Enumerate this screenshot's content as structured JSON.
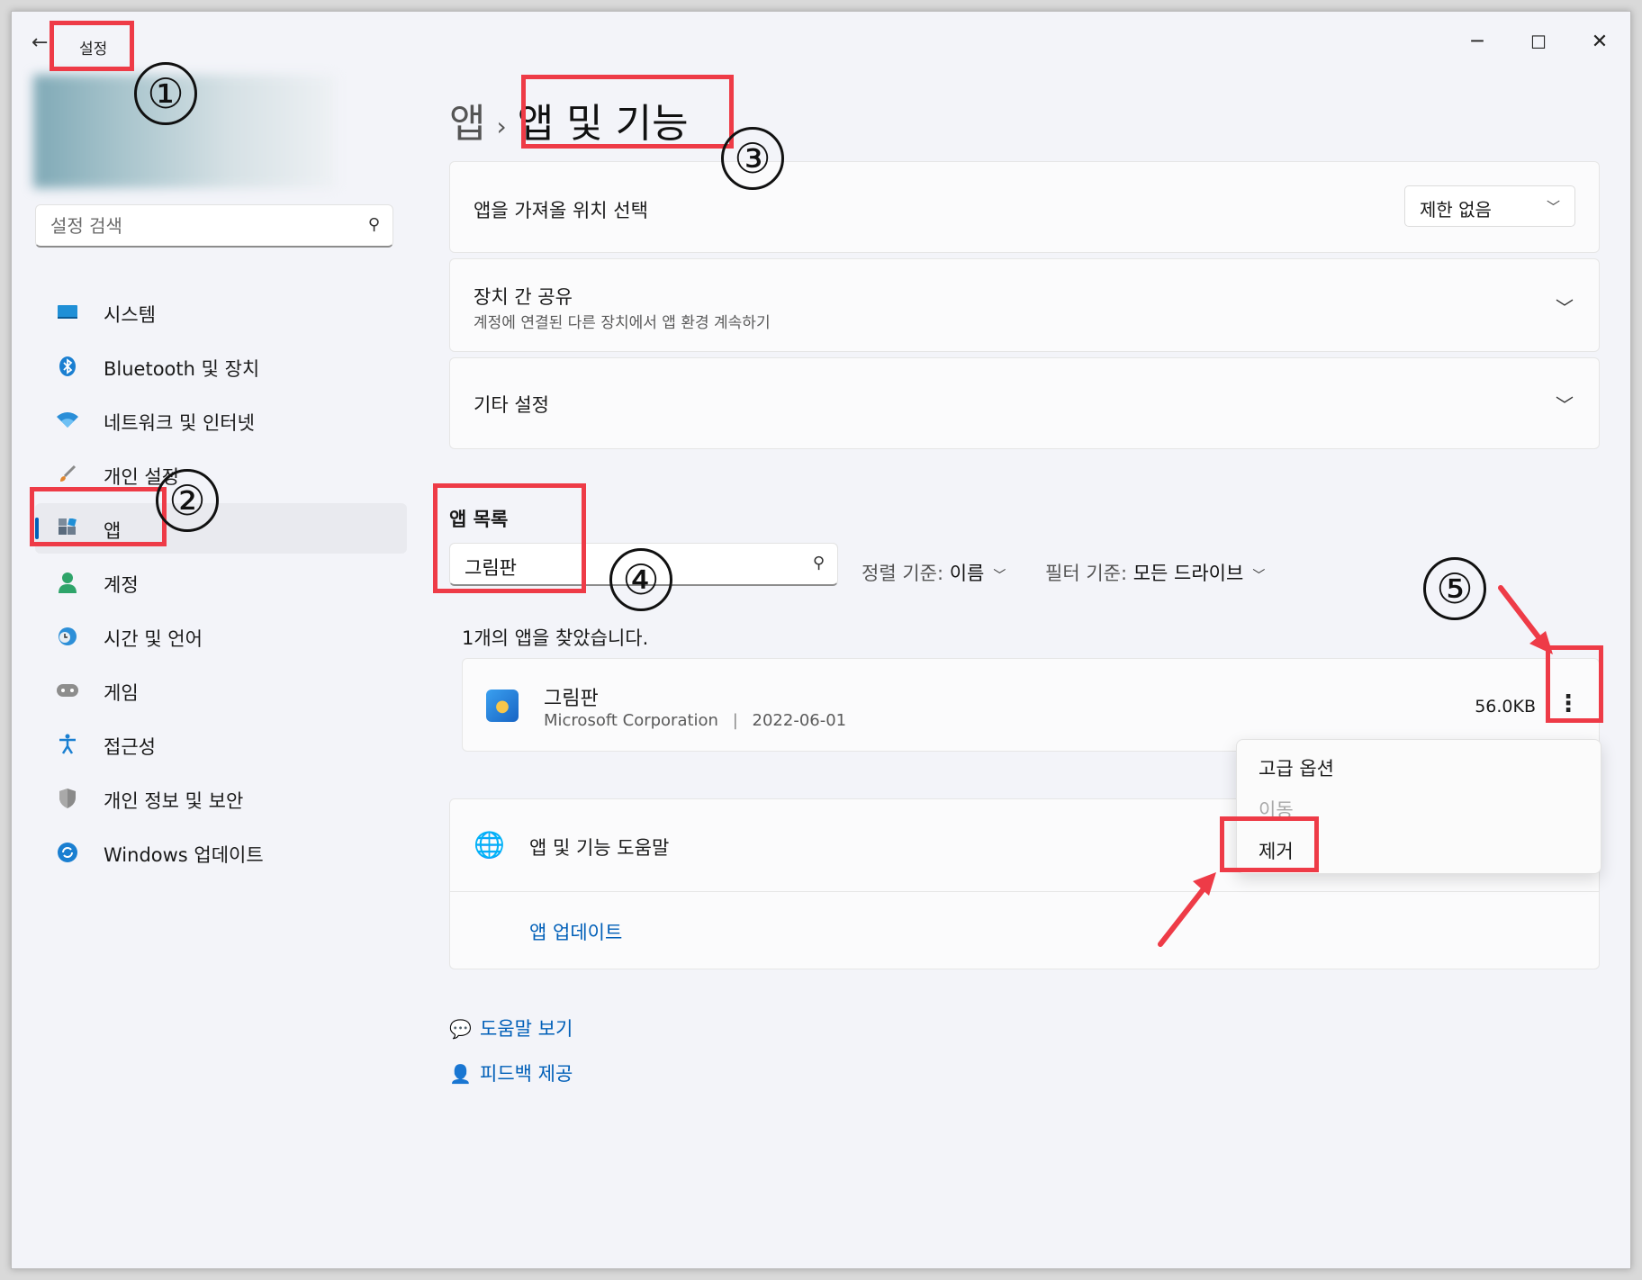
{
  "window": {
    "title": "설정",
    "back_icon": "←",
    "minimize": "─",
    "maximize": "☐",
    "close": "✕"
  },
  "sidebar": {
    "search_placeholder": "설정 검색",
    "items": [
      {
        "label": "시스템",
        "icon": "monitor-icon"
      },
      {
        "label": "Bluetooth 및 장치",
        "icon": "bluetooth-icon"
      },
      {
        "label": "네트워크 및 인터넷",
        "icon": "wifi-icon"
      },
      {
        "label": "개인 설정",
        "icon": "brush-icon"
      },
      {
        "label": "앱",
        "icon": "apps-icon",
        "active": true
      },
      {
        "label": "계정",
        "icon": "person-icon"
      },
      {
        "label": "시간 및 언어",
        "icon": "globe-clock-icon"
      },
      {
        "label": "게임",
        "icon": "gamepad-icon"
      },
      {
        "label": "접근성",
        "icon": "accessibility-icon"
      },
      {
        "label": "개인 정보 및 보안",
        "icon": "shield-icon"
      },
      {
        "label": "Windows 업데이트",
        "icon": "update-icon"
      }
    ]
  },
  "breadcrumb": {
    "parent": "앱",
    "separator": "›",
    "current": "앱 및 기능"
  },
  "cards": {
    "source": {
      "title": "앱을 가져올 위치 선택",
      "dropdown_value": "제한 없음"
    },
    "share": {
      "title": "장치 간 공유",
      "subtitle": "계정에 연결된 다른 장치에서 앱 환경 계속하기"
    },
    "more": {
      "title": "기타 설정"
    }
  },
  "app_list": {
    "label": "앱 목록",
    "search_value": "그림판",
    "sort_prefix": "정렬 기준:",
    "sort_value": "이름",
    "filter_prefix": "필터 기준:",
    "filter_value": "모든 드라이브",
    "found_text": "1개의 앱을 찾았습니다.",
    "apps": [
      {
        "name": "그림판",
        "publisher": "Microsoft Corporation",
        "date": "2022-06-01",
        "size": "56.0KB"
      }
    ]
  },
  "context_menu": {
    "items": [
      {
        "label": "고급 옵션",
        "enabled": true
      },
      {
        "label": "이동",
        "enabled": false
      },
      {
        "label": "제거",
        "enabled": true
      }
    ]
  },
  "help": {
    "title": "앱 및 기능 도움말",
    "link": "앱 업데이트"
  },
  "footer": {
    "get_help": "도움말 보기",
    "feedback": "피드백 제공"
  },
  "annotations": {
    "steps": [
      "①",
      "②",
      "③",
      "④",
      "⑤"
    ],
    "highlight_color": "#ee3b47"
  }
}
